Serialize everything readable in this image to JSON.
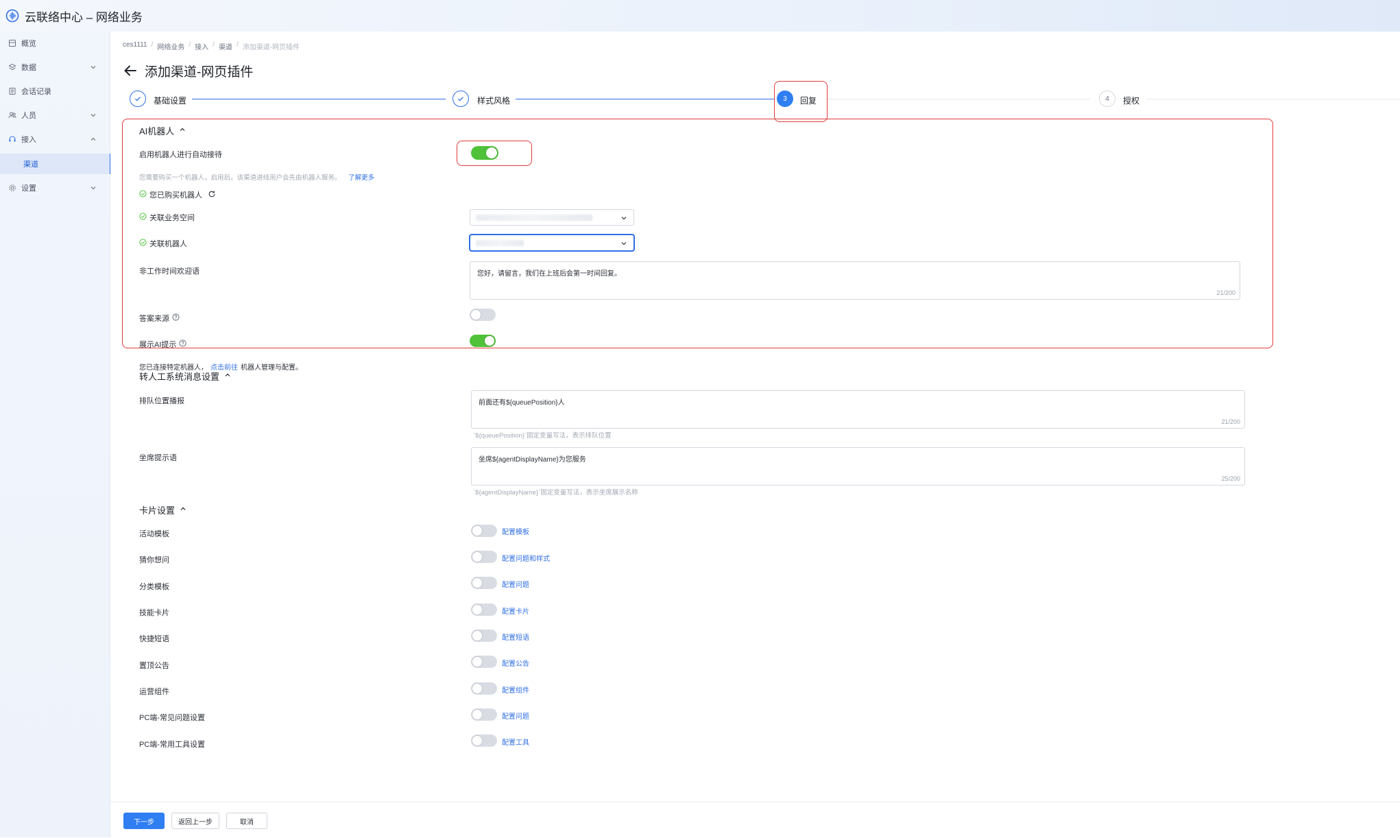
{
  "app": {
    "title": "云联络中心 – 网络业务"
  },
  "sidebar": {
    "items": [
      {
        "label": "概览",
        "icon": "overview-icon"
      },
      {
        "label": "数据",
        "icon": "data-icon"
      },
      {
        "label": "会话记录",
        "icon": "records-icon"
      },
      {
        "label": "人员",
        "icon": "people-icon"
      },
      {
        "label": "接入",
        "icon": "headset-icon"
      },
      {
        "label": "渠道"
      },
      {
        "label": "设置",
        "icon": "gear-icon"
      }
    ]
  },
  "breadcrumb": [
    "ces1111",
    "网络业务",
    "接入",
    "渠道",
    "添加渠道-网页插件"
  ],
  "page": {
    "title": "添加渠道-网页插件"
  },
  "steps": [
    {
      "label": "基础设置",
      "status": "done"
    },
    {
      "label": "样式风格",
      "status": "done"
    },
    {
      "num": "3",
      "label": "回复",
      "status": "active"
    },
    {
      "num": "4",
      "label": "授权",
      "status": "pending"
    }
  ],
  "ai_robot": {
    "section_title": "AI机器人",
    "enable_label": "启用机器人进行自动接待",
    "enable_on": true,
    "hint": "您需要购买一个机器人，启用后，该渠道进线用户会先由机器人服务。",
    "learn_more": "了解更多",
    "purchased_label": "您已购买机器人",
    "workspace_label": "关联业务空间",
    "robot_label": "关联机器人",
    "offhours_label": "非工作时间欢迎语",
    "offhours_text": "您好，请留言，我们在上班后会第一时间回复。",
    "offhours_count": "21/200",
    "answer_source_label": "答案来源",
    "answer_source_on": false,
    "show_ai_label": "展示AI提示",
    "show_ai_on": true
  },
  "robot_note": {
    "prefix": "您已连接特定机器人，",
    "link": "点击前往",
    "suffix": "机器人管理与配置。"
  },
  "transfer": {
    "section_title": "转人工系统消息设置",
    "queue_label": "排队位置播报",
    "queue_text": "前面还有${queuePosition}人",
    "queue_count": "21/200",
    "queue_hint": "`${queuePosition}`固定变量写法，表示排队位置",
    "agent_label": "坐席提示语",
    "agent_text": "坐席${agentDisplayName}为您服务",
    "agent_count": "25/200",
    "agent_hint": "`${agentDisplayName}`固定变量写法，表示坐席展示名称"
  },
  "cards": {
    "section_title": "卡片设置",
    "items": [
      {
        "label": "活动模板",
        "link": "配置模板",
        "on": false
      },
      {
        "label": "猜你想问",
        "link": "配置问题和样式",
        "on": false
      },
      {
        "label": "分类模板",
        "link": "配置问题",
        "on": false
      },
      {
        "label": "技能卡片",
        "link": "配置卡片",
        "on": false
      },
      {
        "label": "快捷短语",
        "link": "配置短语",
        "on": false
      },
      {
        "label": "置顶公告",
        "link": "配置公告",
        "on": false
      },
      {
        "label": "运营组件",
        "link": "配置组件",
        "on": false
      },
      {
        "label": "PC端-常见问题设置",
        "link": "配置问题",
        "on": false
      },
      {
        "label": "PC端-常用工具设置",
        "link": "配置工具",
        "on": false
      }
    ]
  },
  "footer": {
    "next": "下一步",
    "prev": "返回上一步",
    "cancel": "取消"
  },
  "colors": {
    "accent": "#2f6fe4",
    "toggle_on": "#4fc23a",
    "highlight": "#e23a3a"
  }
}
